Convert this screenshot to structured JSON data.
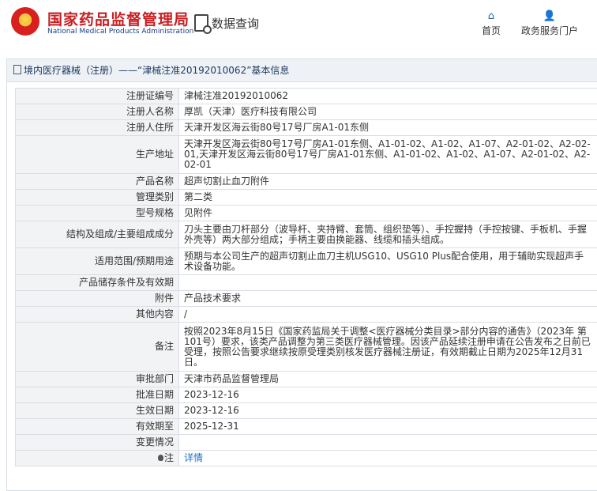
{
  "header": {
    "logo_cn": "国家药品监督管理局",
    "logo_en": "National Medical Products Administration",
    "query_label": "数据查询",
    "nav_home": "首页",
    "nav_service": "政务服务门户"
  },
  "panel": {
    "title": "境内医疗器械（注册）——“津械注准20192010062”基本信息"
  },
  "rows": [
    {
      "label": "注册证编号",
      "value": "津械注准20192010062"
    },
    {
      "label": "注册人名称",
      "value": "厚凯（天津）医疗科技有限公司"
    },
    {
      "label": "注册人住所",
      "value": "天津开发区海云街80号17号厂房A1-01东侧"
    },
    {
      "label": "生产地址",
      "value": "天津开发区海云街80号17号厂房A1-01东侧、A1-01-02、A1-02、A1-07、A2-01-02、A2-02-01,天津开发区海云街80号17号厂房A1-01东侧、A1-01-02、A1-02、A1-07、A2-01-02、A2-02-01"
    },
    {
      "label": "产品名称",
      "value": "超声切割止血刀附件"
    },
    {
      "label": "管理类别",
      "value": "第二类"
    },
    {
      "label": "型号规格",
      "value": "见附件"
    },
    {
      "label": "结构及组成/主要组成成分",
      "value": "刀头主要由刀杆部分（波导杆、夹持臂、套筒、组织垫等）、手控握持（手控按键、手板机、手握外壳等）两大部分组成；手柄主要由换能器、线缆和插头组成。"
    },
    {
      "label": "适用范围/预期用途",
      "value": "预期与本公司生产的超声切割止血刀主机USG10、USG10 Plus配合使用，用于辅助实现超声手术设备功能。"
    },
    {
      "label": "产品储存条件及有效期",
      "value": ""
    },
    {
      "label": "附件",
      "value": "产品技术要求"
    },
    {
      "label": "其他内容",
      "value": "/"
    },
    {
      "label": "备注",
      "value": "按照2023年8月15日《国家药监局关于调整<医疗器械分类目录>部分内容的通告》（2023年 第101号）要求，该类产品调整为第三类医疗器械管理。因该产品延续注册申请在公告发布之日前已受理，按照公告要求继续按原受理类别核发医疗器械注册证，有效期截止日期为2025年12月31日。"
    },
    {
      "label": "审批部门",
      "value": "天津市药品监督管理局"
    },
    {
      "label": "批准日期",
      "value": "2023-12-16"
    },
    {
      "label": "生效日期",
      "value": "2023-12-16"
    },
    {
      "label": "有效期至",
      "value": "2025-12-31"
    },
    {
      "label": "变更情况",
      "value": ""
    }
  ],
  "note_row": {
    "label": "注",
    "link": "详情"
  }
}
